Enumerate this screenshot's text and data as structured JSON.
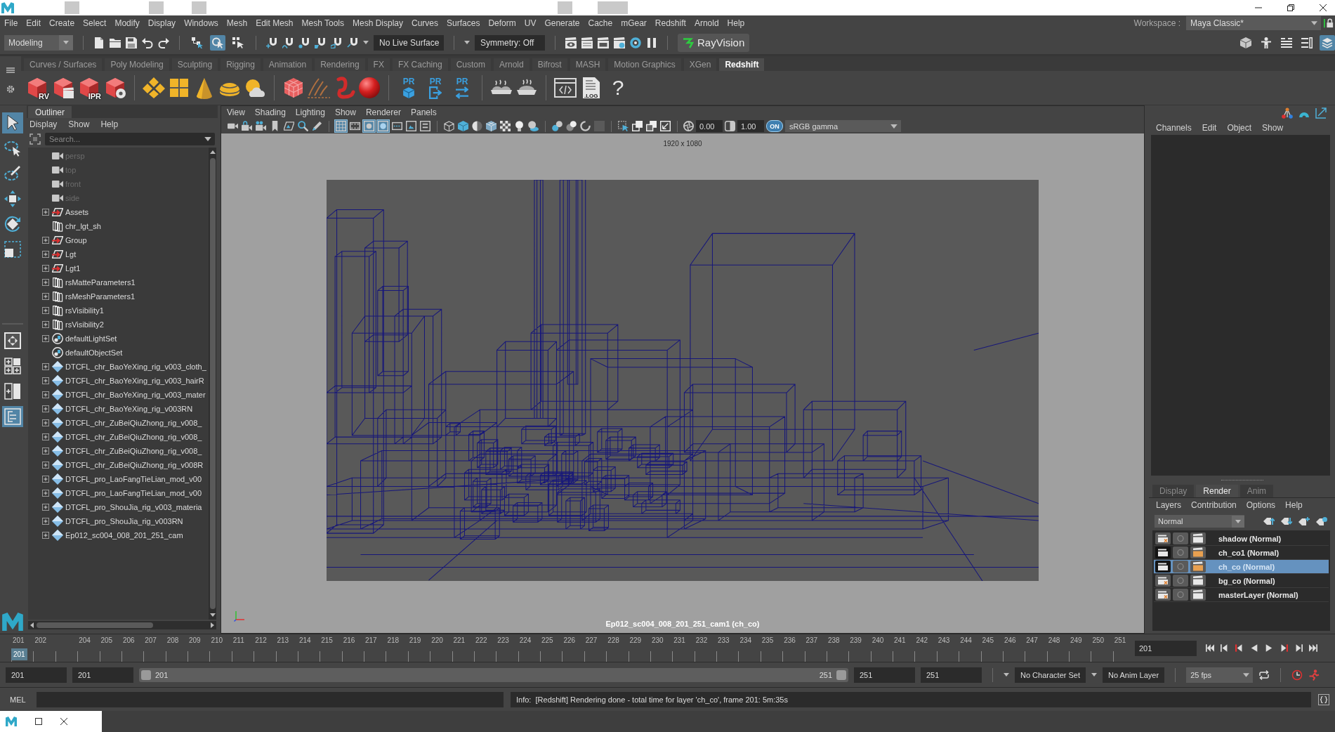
{
  "menu_bar": {
    "items": [
      "File",
      "Edit",
      "Create",
      "Select",
      "Modify",
      "Display",
      "Windows",
      "Mesh",
      "Edit Mesh",
      "Mesh Tools",
      "Mesh Display",
      "Curves",
      "Surfaces",
      "Deform",
      "UV",
      "Generate",
      "Cache",
      "mGear",
      "Redshift",
      "Arnold",
      "Help"
    ],
    "workspace_label": "Workspace :",
    "workspace": "Maya Classic*"
  },
  "status_line": {
    "menu_set": "Modeling",
    "select_modes": [
      {
        "kind": "hierarchy",
        "selected": false
      },
      {
        "kind": "object",
        "selected": true
      },
      {
        "kind": "component",
        "selected": false
      }
    ],
    "live_surface": "No Live Surface",
    "symmetry": "Symmetry: Off",
    "plugin_button": "RayVision",
    "panel_toggles": [
      {
        "kind": "cube-tools",
        "selected": false
      },
      {
        "kind": "figure",
        "selected": false
      },
      {
        "kind": "list-lines",
        "selected": false
      },
      {
        "kind": "list-boxes",
        "selected": false
      },
      {
        "kind": "stacked-layers",
        "selected": true
      }
    ]
  },
  "shelf": {
    "tabs": [
      {
        "label": "Curves / Surfaces",
        "selected": false
      },
      {
        "label": "Poly Modeling",
        "selected": false
      },
      {
        "label": "Sculpting",
        "selected": false
      },
      {
        "label": "Rigging",
        "selected": false
      },
      {
        "label": "Animation",
        "selected": false
      },
      {
        "label": "Rendering",
        "selected": false
      },
      {
        "label": "FX",
        "selected": false
      },
      {
        "label": "FX Caching",
        "selected": false
      },
      {
        "label": "Custom",
        "selected": false
      },
      {
        "label": "Arnold",
        "selected": false
      },
      {
        "label": "Bifrost",
        "selected": false
      },
      {
        "label": "MASH",
        "selected": false
      },
      {
        "label": "Motion Graphics",
        "selected": false
      },
      {
        "label": "XGen",
        "selected": false
      },
      {
        "label": "Redshift",
        "selected": true
      }
    ],
    "button_groups": [
      [
        {
          "kind": "cube",
          "label": "RV"
        },
        {
          "kind": "cube-clapper"
        },
        {
          "kind": "cube",
          "label": "IPR"
        },
        {
          "kind": "cube-gear"
        }
      ],
      [
        {
          "kind": "diamonds"
        },
        {
          "kind": "four-panel-square"
        },
        {
          "kind": "cone"
        },
        {
          "kind": "dome"
        },
        {
          "kind": "sun-cloud"
        }
      ],
      [
        {
          "kind": "cube-grid"
        },
        {
          "kind": "streak-lines"
        },
        {
          "kind": "worm-curve"
        },
        {
          "kind": "sphere"
        }
      ],
      [
        {
          "kind": "small-cube",
          "label": "PR"
        },
        {
          "kind": "export-arrow",
          "label": "PR"
        },
        {
          "kind": "swap-arrows",
          "label": "PR"
        }
      ],
      [
        {
          "kind": "pie-pair"
        },
        {
          "kind": "pie"
        }
      ],
      [
        {
          "kind": "script-window"
        },
        {
          "kind": "log-document",
          "label": ".LOG"
        },
        {
          "kind": "question",
          "label": "?"
        }
      ]
    ]
  },
  "toolbox": {
    "tools": [
      {
        "kind": "arrow",
        "selected": true
      },
      {
        "kind": "lasso",
        "selected": false
      },
      {
        "kind": "paint-lasso",
        "selected": false
      },
      {
        "kind": "move",
        "selected": false
      },
      {
        "kind": "rotate",
        "selected": false
      },
      {
        "kind": "scale",
        "selected": false
      }
    ],
    "layouts": [
      {
        "kind": "single-pane",
        "selected": false
      },
      {
        "kind": "four-pane",
        "selected": false
      },
      {
        "kind": "two-pane",
        "selected": false
      },
      {
        "kind": "outliner-pane",
        "selected": true
      }
    ]
  },
  "outliner": {
    "title": "Outliner",
    "menu": [
      "Display",
      "Show",
      "Help"
    ],
    "search": {
      "placeholder": "Search..."
    },
    "items": [
      {
        "kind": "camera",
        "label": "persp",
        "expandable": false,
        "dimmed": true
      },
      {
        "kind": "camera",
        "label": "top",
        "expandable": false,
        "dimmed": true
      },
      {
        "kind": "camera",
        "label": "front",
        "expandable": false,
        "dimmed": true
      },
      {
        "kind": "camera",
        "label": "side",
        "expandable": false,
        "dimmed": true
      },
      {
        "kind": "group",
        "label": "Assets",
        "expandable": true,
        "dimmed": false
      },
      {
        "kind": "node",
        "label": "chr_lgt_sh",
        "expandable": false,
        "dimmed": false
      },
      {
        "kind": "group",
        "label": "Group",
        "expandable": true,
        "dimmed": false
      },
      {
        "kind": "group",
        "label": "Lgt",
        "expandable": true,
        "dimmed": false
      },
      {
        "kind": "group",
        "label": "Lgt1",
        "expandable": true,
        "dimmed": false
      },
      {
        "kind": "node",
        "label": "rsMatteParameters1",
        "expandable": true,
        "dimmed": false
      },
      {
        "kind": "node",
        "label": "rsMeshParameters1",
        "expandable": true,
        "dimmed": false
      },
      {
        "kind": "node",
        "label": "rsVisibility1",
        "expandable": true,
        "dimmed": false
      },
      {
        "kind": "node",
        "label": "rsVisibility2",
        "expandable": true,
        "dimmed": false
      },
      {
        "kind": "set",
        "label": "defaultLightSet",
        "expandable": true,
        "dimmed": false
      },
      {
        "kind": "set",
        "label": "defaultObjectSet",
        "expandable": false,
        "dimmed": false
      },
      {
        "kind": "reference",
        "label": "DTCFL_chr_BaoYeXing_rig_v003_cloth_",
        "expandable": true,
        "dimmed": false
      },
      {
        "kind": "reference",
        "label": "DTCFL_chr_BaoYeXing_rig_v003_hairR",
        "expandable": true,
        "dimmed": false
      },
      {
        "kind": "reference",
        "label": "DTCFL_chr_BaoYeXing_rig_v003_mater",
        "expandable": true,
        "dimmed": false
      },
      {
        "kind": "reference",
        "label": "DTCFL_chr_BaoYeXing_rig_v003RN",
        "expandable": true,
        "dimmed": false
      },
      {
        "kind": "reference",
        "label": "DTCFL_chr_ZuBeiQiuZhong_rig_v008_",
        "expandable": true,
        "dimmed": false
      },
      {
        "kind": "reference",
        "label": "DTCFL_chr_ZuBeiQiuZhong_rig_v008_",
        "expandable": true,
        "dimmed": false
      },
      {
        "kind": "reference",
        "label": "DTCFL_chr_ZuBeiQiuZhong_rig_v008_",
        "expandable": true,
        "dimmed": false
      },
      {
        "kind": "reference",
        "label": "DTCFL_chr_ZuBeiQiuZhong_rig_v008R",
        "expandable": true,
        "dimmed": false
      },
      {
        "kind": "reference",
        "label": "DTCFL_pro_LaoFangTieLian_mod_v00",
        "expandable": true,
        "dimmed": false
      },
      {
        "kind": "reference",
        "label": "DTCFL_pro_LaoFangTieLian_mod_v00",
        "expandable": true,
        "dimmed": false
      },
      {
        "kind": "reference",
        "label": "DTCFL_pro_ShouJia_rig_v003_materia",
        "expandable": true,
        "dimmed": false
      },
      {
        "kind": "reference",
        "label": "DTCFL_pro_ShouJia_rig_v003RN",
        "expandable": true,
        "dimmed": false
      },
      {
        "kind": "reference",
        "label": "Ep012_sc004_008_201_251_cam",
        "expandable": true,
        "dimmed": false
      }
    ]
  },
  "viewport": {
    "menu": [
      "View",
      "Shading",
      "Lighting",
      "Show",
      "Renderer",
      "Panels"
    ],
    "toolbar_groups": [
      [
        {
          "kind": "camera",
          "selected": false
        },
        {
          "kind": "camera-lock",
          "selected": false
        },
        {
          "kind": "camera-dots",
          "selected": false
        },
        {
          "kind": "bookmark",
          "selected": false
        },
        {
          "kind": "image-plane",
          "selected": false
        },
        {
          "kind": "magnifier",
          "selected": false
        },
        {
          "kind": "pencil",
          "selected": false
        }
      ],
      [
        {
          "kind": "grid",
          "selected": true
        },
        {
          "kind": "film-strip",
          "selected": false
        },
        {
          "kind": "gate-frame",
          "selected": true
        },
        {
          "kind": "gate-mask",
          "selected": true
        },
        {
          "kind": "field-chart",
          "selected": false
        },
        {
          "kind": "safe-frame",
          "selected": false
        },
        {
          "kind": "title-frame",
          "selected": false
        }
      ],
      [
        {
          "kind": "wire-cube",
          "selected": false
        },
        {
          "kind": "solid-cube",
          "selected": false
        },
        {
          "kind": "half-sphere",
          "selected": false
        },
        {
          "kind": "wire-shaded-cube",
          "selected": false
        },
        {
          "kind": "checker",
          "selected": false
        },
        {
          "kind": "light-bulb",
          "selected": false
        },
        {
          "kind": "shadow-sphere",
          "selected": false
        }
      ],
      [
        {
          "kind": "ao-spheres",
          "selected": false
        },
        {
          "kind": "blur-spheres",
          "selected": false
        },
        {
          "kind": "ring",
          "selected": false
        },
        {
          "kind": "dim-square",
          "selected": false
        }
      ],
      [
        {
          "kind": "select-arrow-box",
          "selected": false
        },
        {
          "kind": "stacked-squares",
          "selected": false
        },
        {
          "kind": "xray-squares",
          "selected": false
        },
        {
          "kind": "corner-square",
          "selected": false
        }
      ]
    ],
    "exposure": "0.00",
    "gamma": "1.00",
    "color_management": "ON",
    "view_transform": "sRGB gamma",
    "resolution": "1920 x 1080",
    "camera": "Ep012_sc004_008_201_251_cam1 (ch_co)"
  },
  "channel_box": {
    "menu": [
      "Channels",
      "Edit",
      "Object",
      "Show"
    ]
  },
  "layer_editor": {
    "tabs": [
      {
        "label": "Display",
        "selected": false
      },
      {
        "label": "Render",
        "selected": true
      },
      {
        "label": "Anim",
        "selected": false
      }
    ],
    "menu": [
      "Layers",
      "Contribution",
      "Options",
      "Help"
    ],
    "mode": "Normal",
    "layers": [
      {
        "name": "shadow (Normal)",
        "renderable": false,
        "selected": false
      },
      {
        "name": "ch_co1 (Normal)",
        "renderable": true,
        "selected": false
      },
      {
        "name": "ch_co (Normal)",
        "renderable": true,
        "selected": true
      },
      {
        "name": "bg_co (Normal)",
        "renderable": false,
        "selected": false
      },
      {
        "name": "masterLayer (Normal)",
        "renderable": false,
        "selected": false
      }
    ]
  },
  "time_slider": {
    "frames": [
      {
        "label": "201",
        "current": true
      },
      {
        "label": "202",
        "current": false
      },
      {
        "current": false
      },
      {
        "label": "204",
        "current": false
      },
      {
        "label": "205",
        "current": false
      },
      {
        "label": "206",
        "current": false
      },
      {
        "label": "207",
        "current": false
      },
      {
        "label": "208",
        "current": false
      },
      {
        "label": "209",
        "current": false
      },
      {
        "label": "210",
        "current": false
      },
      {
        "label": "211",
        "current": false
      },
      {
        "label": "212",
        "current": false
      },
      {
        "label": "213",
        "current": false
      },
      {
        "label": "214",
        "current": false
      },
      {
        "label": "215",
        "current": false
      },
      {
        "label": "216",
        "current": false
      },
      {
        "label": "217",
        "current": false
      },
      {
        "label": "218",
        "current": false
      },
      {
        "label": "219",
        "current": false
      },
      {
        "label": "220",
        "current": false
      },
      {
        "label": "221",
        "current": false
      },
      {
        "label": "222",
        "current": false
      },
      {
        "label": "223",
        "current": false
      },
      {
        "label": "224",
        "current": false
      },
      {
        "label": "225",
        "current": false
      },
      {
        "label": "226",
        "current": false
      },
      {
        "label": "227",
        "current": false
      },
      {
        "label": "228",
        "current": false
      },
      {
        "label": "229",
        "current": false
      },
      {
        "label": "230",
        "current": false
      },
      {
        "label": "231",
        "current": false
      },
      {
        "label": "232",
        "current": false
      },
      {
        "label": "233",
        "current": false
      },
      {
        "label": "234",
        "current": false
      },
      {
        "label": "235",
        "current": false
      },
      {
        "label": "236",
        "current": false
      },
      {
        "label": "237",
        "current": false
      },
      {
        "label": "238",
        "current": false
      },
      {
        "label": "239",
        "current": false
      },
      {
        "label": "240",
        "current": false
      },
      {
        "label": "241",
        "current": false
      },
      {
        "label": "242",
        "current": false
      },
      {
        "label": "243",
        "current": false
      },
      {
        "label": "244",
        "current": false
      },
      {
        "label": "245",
        "current": false
      },
      {
        "label": "246",
        "current": false
      },
      {
        "label": "247",
        "current": false
      },
      {
        "label": "248",
        "current": false
      },
      {
        "label": "249",
        "current": false
      },
      {
        "label": "250",
        "current": false
      },
      {
        "label": "251",
        "current": false
      }
    ],
    "current_marker": "201",
    "current_time": "201"
  },
  "range_slider": {
    "start": "201",
    "inner_start": "201",
    "level": 1,
    "slider_start": "201",
    "slider_end": "251",
    "inner_end": "251",
    "end": "251",
    "character_set": "No Character Set",
    "anim_layer": "No Anim Layer",
    "fps": "25 fps"
  },
  "command_line": {
    "language": "MEL",
    "result": "Info:  [Redshift] Rendering done - total time for layer 'ch_co', frame 201: 5m:35s"
  }
}
